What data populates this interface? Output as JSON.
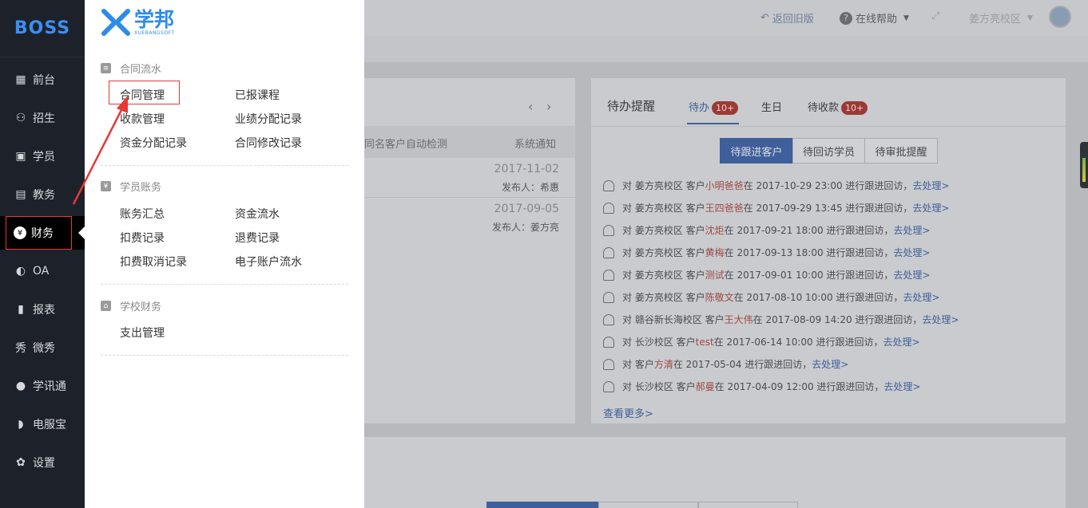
{
  "sidebar": {
    "brand": "BOSS",
    "items": [
      {
        "label": "前台",
        "icon": "calendar-icon"
      },
      {
        "label": "招生",
        "icon": "user-add-icon"
      },
      {
        "label": "学员",
        "icon": "id-card-icon"
      },
      {
        "label": "教务",
        "icon": "book-icon"
      },
      {
        "label": "财务",
        "icon": "yen-icon"
      },
      {
        "label": "OA",
        "icon": "toggle-icon"
      },
      {
        "label": "报表",
        "icon": "bar-chart-icon"
      },
      {
        "label": "微秀",
        "icon": "weixiu-icon"
      },
      {
        "label": "学讯通",
        "icon": "location-pin-icon"
      },
      {
        "label": "电服宝",
        "icon": "phone-icon"
      },
      {
        "label": "设置",
        "icon": "gear-icon"
      }
    ],
    "active": "财务"
  },
  "header": {
    "back_label": "返回旧版",
    "help_label": "在线帮助",
    "campus": "姜方亮校区"
  },
  "flyout": {
    "logo_cn": "学邦",
    "logo_en": "XUEBANGSOFT",
    "sections": [
      {
        "title": "合同流水",
        "items": [
          "合同管理",
          "已报课程",
          "收款管理",
          "业绩分配记录",
          "资金分配记录",
          "合同修改记录"
        ]
      },
      {
        "title": "学员账务",
        "items": [
          "账务汇总",
          "资金流水",
          "扣费记录",
          "退费记录",
          "扣费取消记录",
          "电子账户流水"
        ]
      },
      {
        "title": "学校财务",
        "items": [
          "支出管理"
        ]
      }
    ]
  },
  "notice": {
    "col_a": "同名客户自动检测",
    "col_b": "系统通知",
    "rows": [
      {
        "date": "2017-11-02",
        "publisher": "发布人：希惠"
      },
      {
        "date": "2017-09-05",
        "publisher": "发布人：姜方亮"
      }
    ]
  },
  "todo": {
    "title": "待办提醒",
    "tabs": [
      {
        "label": "待办",
        "badge": "10+"
      },
      {
        "label": "生日",
        "badge": ""
      },
      {
        "label": "待收款",
        "badge": "10+"
      }
    ],
    "segments": [
      "待跟进客户",
      "待回访学员",
      "待审批提醒"
    ],
    "rows": [
      {
        "pre": "对 姜方亮校区 客户 ",
        "name": "小明爸爸",
        "post": " 在 2017-10-29 23:00 进行跟进回访，",
        "link": "去处理>"
      },
      {
        "pre": "对 姜方亮校区 客户 ",
        "name": "王四爸爸",
        "post": " 在 2017-09-29 13:45 进行跟进回访，",
        "link": "去处理>"
      },
      {
        "pre": "对 姜方亮校区 客户 ",
        "name": "沈炬",
        "post": " 在 2017-09-21 18:00 进行跟进回访，",
        "link": "去处理>"
      },
      {
        "pre": "对 姜方亮校区 客户 ",
        "name": "黄梅",
        "post": " 在 2017-09-13 18:00 进行跟进回访，",
        "link": "去处理>"
      },
      {
        "pre": "对 姜方亮校区 客户 ",
        "name": "测试",
        "post": " 在 2017-09-01 10:00 进行跟进回访，",
        "link": "去处理>"
      },
      {
        "pre": "对 姜方亮校区 客户 ",
        "name": "陈敬文",
        "post": " 在 2017-08-10 10:00 进行跟进回访，",
        "link": "去处理>"
      },
      {
        "pre": "对 赣谷新长海校区 客户 ",
        "name": "王大伟",
        "post": " 在 2017-08-09 14:20 进行跟进回访，",
        "link": "去处理>"
      },
      {
        "pre": "对 长沙校区 客户 ",
        "name": "test",
        "post": " 在 2017-06-14 10:00 进行跟进回访，",
        "link": "去处理>"
      },
      {
        "pre": "对 客户 ",
        "name": "方清",
        "post": " 在 2017-05-04 进行跟进回访，",
        "link": "去处理>"
      },
      {
        "pre": "对 长沙校区 客户 ",
        "name": "郝曼",
        "post": " 在 2017-04-09 12:00 进行跟进回访，",
        "link": "去处理>"
      }
    ],
    "more": "查看更多>"
  }
}
